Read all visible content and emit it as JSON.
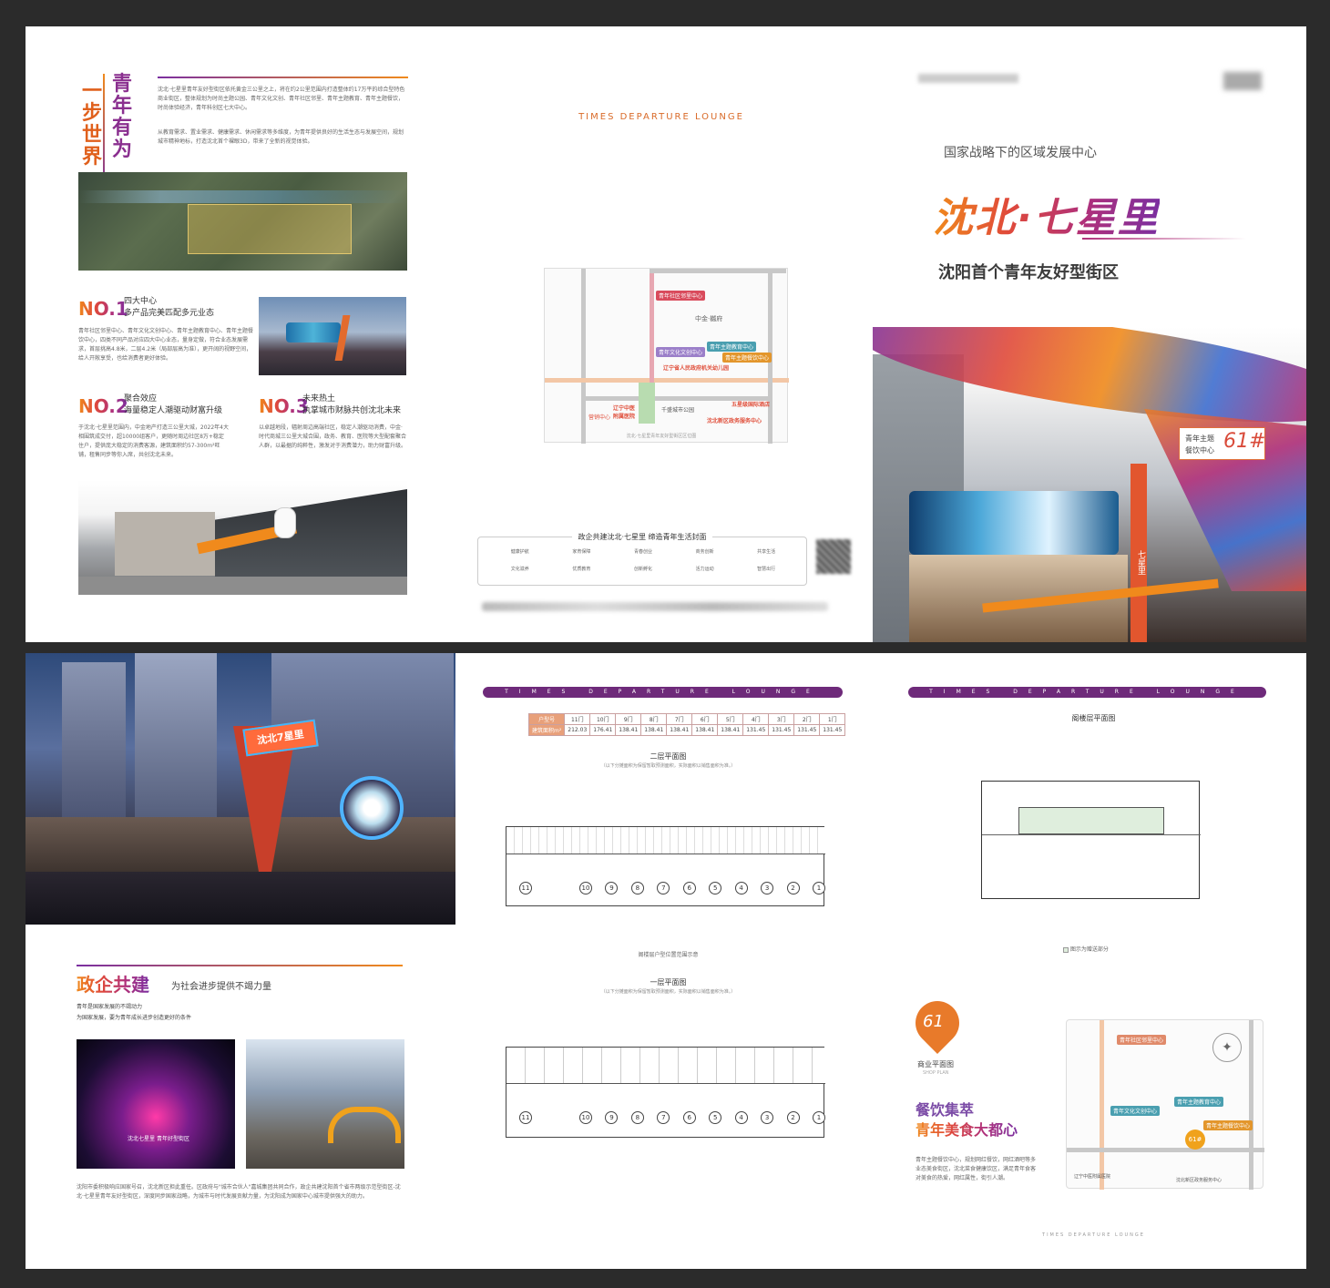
{
  "colors": {
    "accent_orange": "#f08a1c",
    "accent_red": "#e04a3a",
    "accent_purple": "#7b2fa0",
    "bar_purple": "#6e2a7a"
  },
  "p1": {
    "title_a": "青年有为",
    "title_b": "一步世界",
    "intro_1": "沈北·七星里青年友好型街区依托黄金三公里之上，将在约2公里范围内打造整体约17万平的综合型特色商业街区，整体规划为时尚主题公园、青年文化文创、青年社区邻里、青年主题教育、青年主题餐饮，时尚体验经济，青年科创区七大中心。",
    "intro_2": "从教育需求、置业需求、健康需求、休闲需求等多维度，为青年提供良好的生活生态与发展空间，规划城市精神地标，打造沈北首个裸眼3D，带来了全新的视觉体验。",
    "no1_num": "NO.1",
    "no1_title": "四大中心",
    "no1_sub": "多产品完美匹配多元业态",
    "no1_body": "青年社区邻里中心、青年文化文创中心、青年主题教育中心、青年主题餐饮中心，四类不同产品对应四大中心业态，量身定做，符合业态发展需求，首层挑高4.8米，二层4.2米（局部层高为准），更开阔的视野空间，给人开敞享受，也给消费者更好体验。",
    "no2_num": "NO.2",
    "no2_title": "聚合效应",
    "no2_sub": "海量稳定人潮驱动财富升级",
    "no2_body": "于沈北·七星里范围内，中金地产打造三公里大城，2022年4大相围筑成交付，超10000组客户，更随时周边社区8万+稳定住户，提供庞大稳定的消费客源，建筑面积约57-300m²旺铺，租售同步等你入席，共创沈北未来。",
    "no3_num": "NO.3",
    "no3_title": "未来热土",
    "no3_sub": "执掌城市财脉共创沈北未来",
    "no3_body": "以卓越地段，辐射周边高端社区，稳定人潮驱动消费，中金·时代商城三公里大城合围，政务、教育、医院等大型配套聚合人群，以最据的纯粹性，激发对于消费潜力，助力财富升级。"
  },
  "p2": {
    "header": "TIMES DEPARTURE LOUNGE",
    "map_center_label": "中金·樾府",
    "map_labels": [
      "青年社区邻里中心",
      "青年文化文创中心",
      "青年主题教育中心",
      "青年主题餐饮中心",
      "辽宁省人民政府机关幼儿园",
      "沈北新区政务服务中心",
      "五星级国际酒店",
      "辽宁中医附属医院",
      "营销中心",
      "千盛城市公园"
    ],
    "map_caption": "沈北·七星里青年友好型街区区位图",
    "footer_title": "政企共建沈北·七星里 缔造青年生活封面",
    "footer_cols": [
      "健康护航",
      "家育保障",
      "青春创业",
      "商务创新",
      "共享生活",
      "文化滋养",
      "优质教育",
      "创新孵化",
      "活力运动",
      "智慧出行"
    ]
  },
  "p3": {
    "top_blur": "沈北新区融合青年商街",
    "subtitle_top": "国家战略下的区域发展中心",
    "title": "沈北·七星里",
    "tagline": "沈阳首个青年友好型街区",
    "badge_label_1": "青年主题",
    "badge_label_2": "餐饮中心",
    "badge_num": "61#",
    "sign_text": "七星里"
  },
  "p4": {
    "sign_main": "沈北7星里",
    "section_title": "政企共建",
    "section_sub": "为社会进步提供不竭力量",
    "lead_1": "青年是国家发展的不竭动力",
    "lead_2": "为国家发展，要为青年成长进步创造更好的条件",
    "stage_text": "沈北七星里 青年好型街区",
    "body": "沈阳市委积极响应国家号召，沈北新区担此重任。区政府与\"城市合伙人\"嘉城集团共同合作，政企共建沈阳首个省市两级示范型街区-沈北·七星里青年友好型街区，深度同步国家战略，为城市与时代发展贡献力量，为沈阳成为国家中心城市提供强大的助力。"
  },
  "p5": {
    "bar_text": "TIMES DEPARTURE LOUNGE",
    "table_header": [
      "户型号",
      "11门",
      "10门",
      "9门",
      "8门",
      "7门",
      "6门",
      "5门",
      "4门",
      "3门",
      "2门",
      "1门"
    ],
    "table_row": [
      "建筑面积m²",
      "212.03",
      "176.41",
      "138.41",
      "138.41",
      "138.41",
      "138.41",
      "138.41",
      "131.45",
      "131.45",
      "131.45",
      "131.45"
    ],
    "plan2_title": "二层平面图",
    "plan2_note": "（以下分摊面积为保留暂取预测面积，实际面积以销售面积为准。）",
    "plan2_caption": "阁楼层户型位置范围示意",
    "plan1_title": "一层平面图",
    "plan1_note": "（以下分摊面积为保留暂取预测面积，实际面积以销售面积为准。）",
    "unit_numbers": [
      "11",
      "10",
      "9",
      "8",
      "7",
      "6",
      "5",
      "4",
      "3",
      "2",
      "1"
    ]
  },
  "p6": {
    "bar_text": "TIMES DEPARTURE LOUNGE",
    "plan_title": "阁楼层平面图",
    "legend_text": "图示为赠送部分",
    "pin_num": "61",
    "pin_caption": "商业平面图",
    "pin_caption_en": "SHOP PLAN",
    "slogan_1": "餐饮集萃",
    "slogan_2": "青年美食大都心",
    "body": "青年主题餐饮中心，规划网红餐饮，网红酒吧等多业态美食街区，沈北菜食健康饮区，满足青年食客对美食的热爱，网红属性，街引人潮。",
    "map_tags": [
      "青年社区邻里中心",
      "青年文化文创中心",
      "青年主题教育中心",
      "青年主题餐饮中心"
    ],
    "map_bottom": "辽宁中医附属医院",
    "map_bottom_2": "沈北新区政务服务中心",
    "map_marker": "61#",
    "footer": "TIMES DEPARTURE LOUNGE"
  }
}
